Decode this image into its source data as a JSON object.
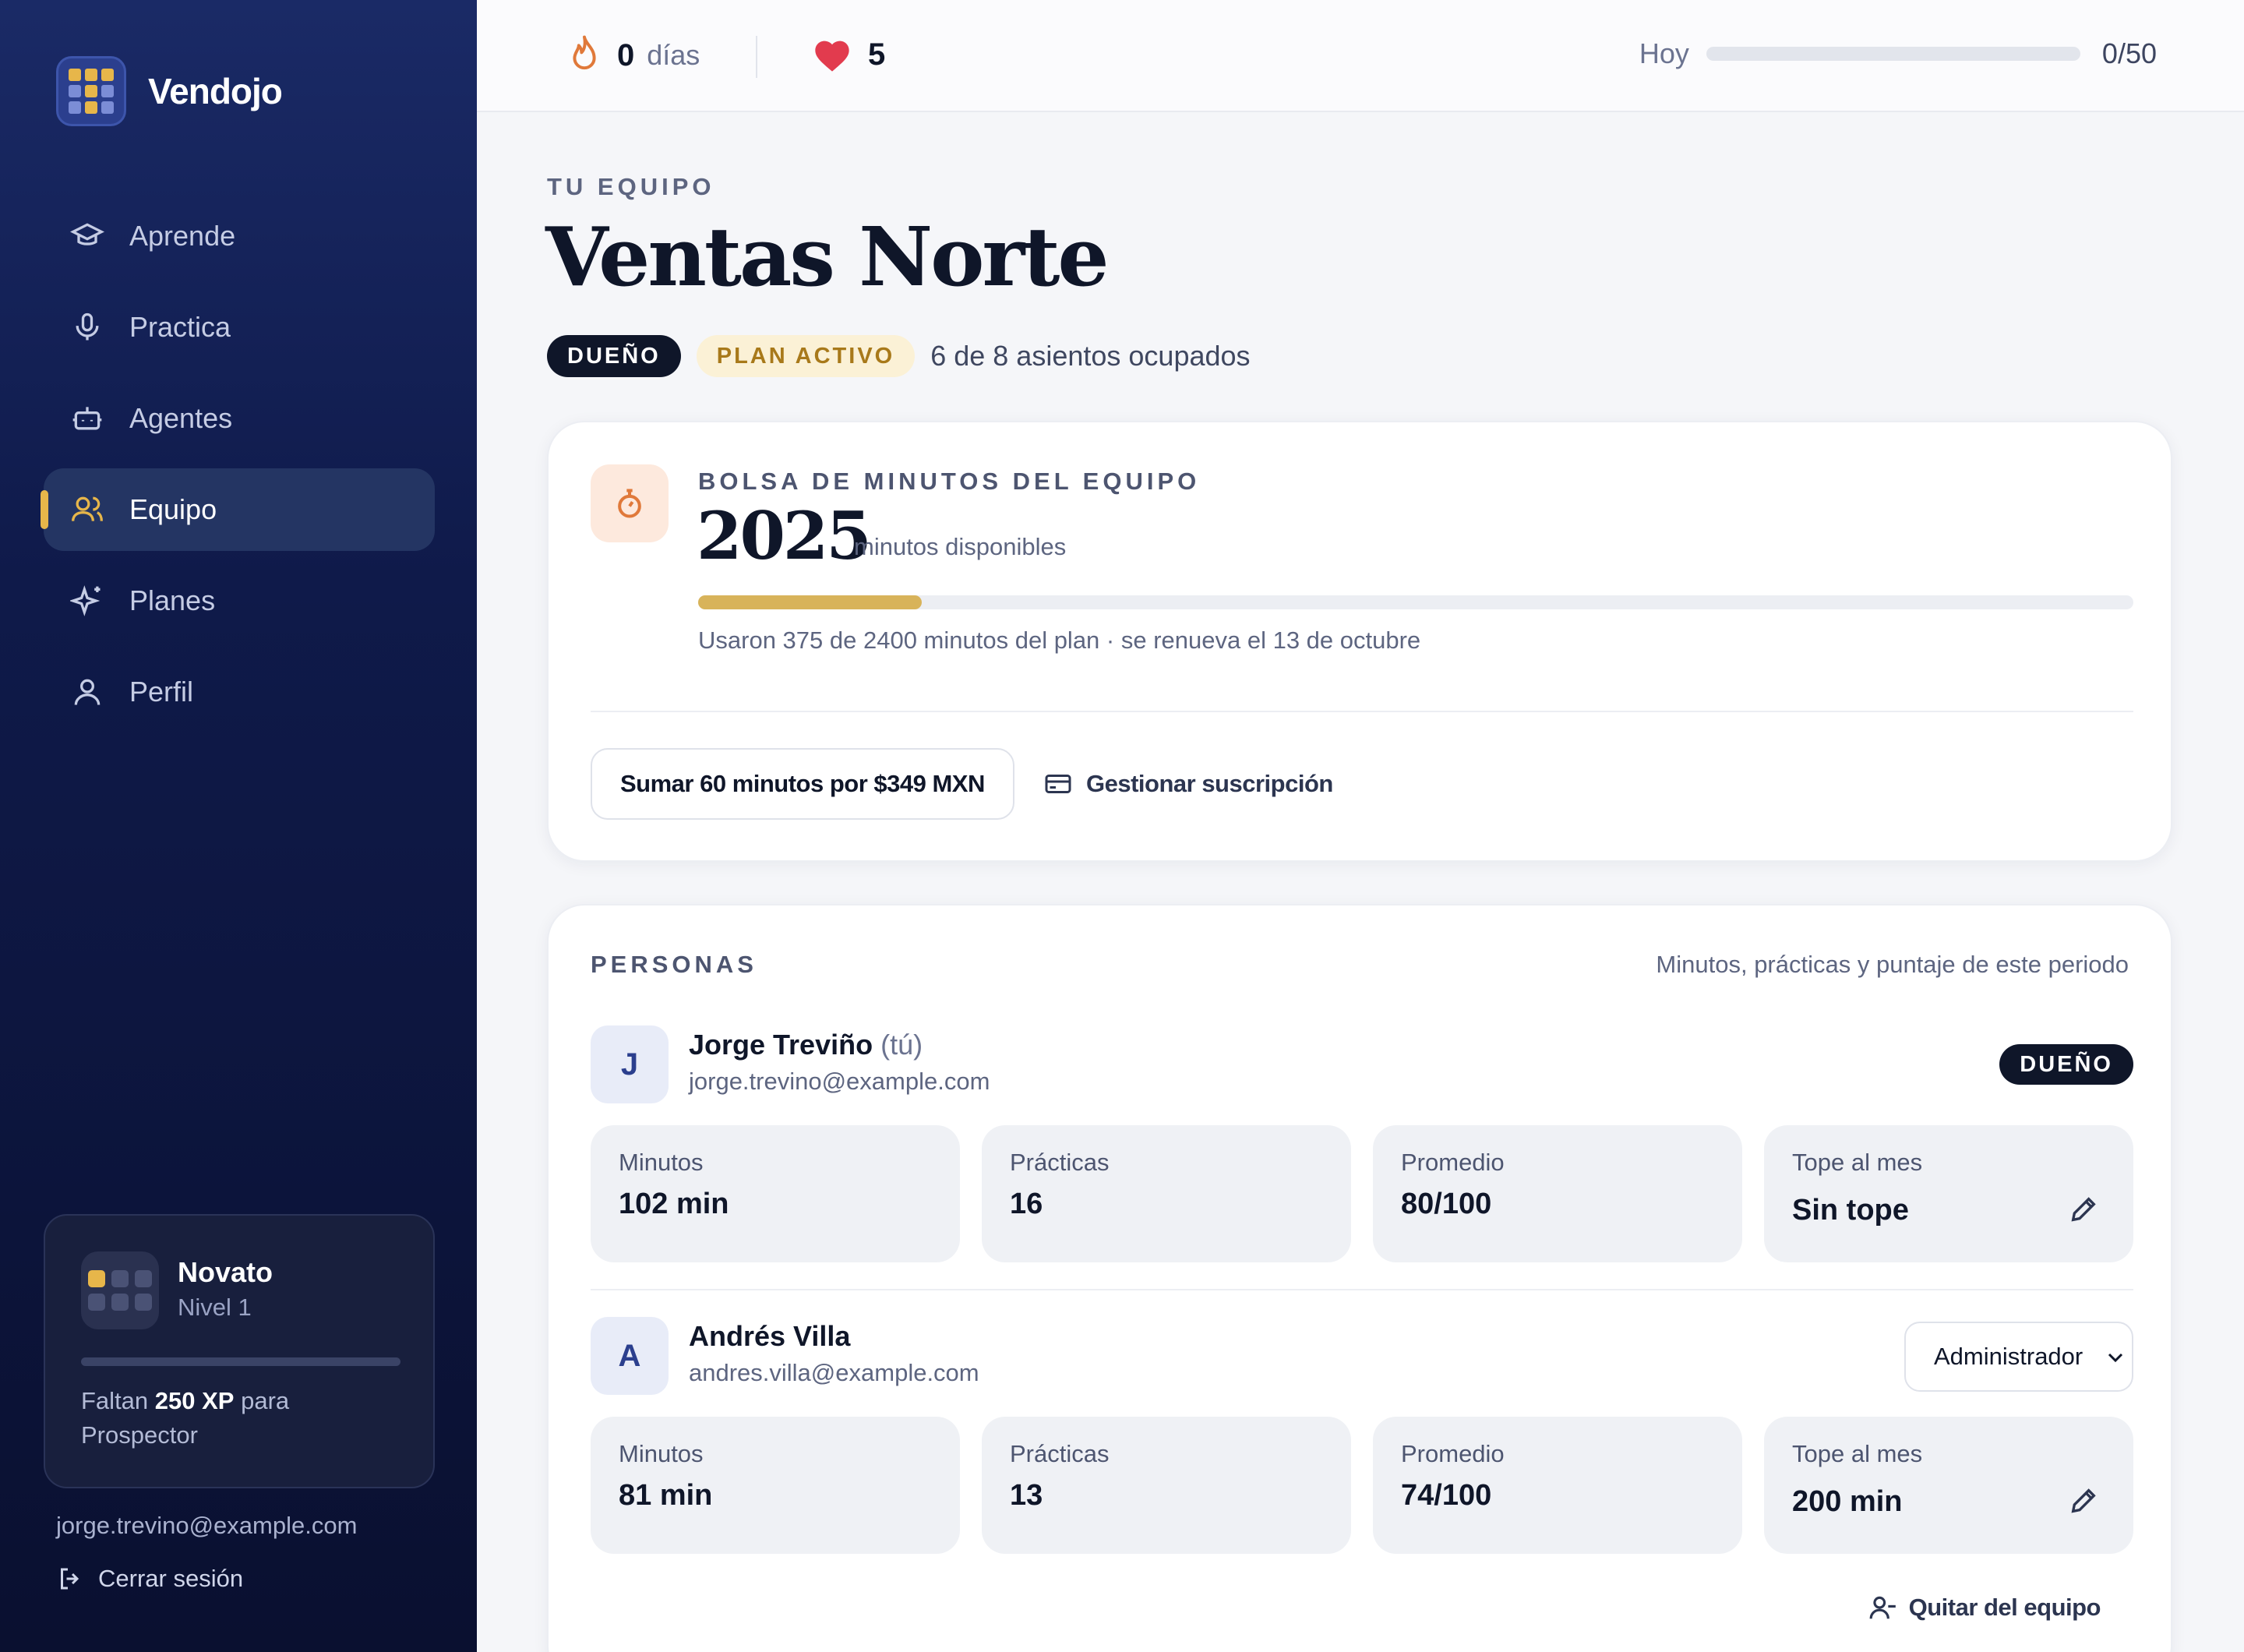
{
  "app": {
    "name": "Vendojo"
  },
  "sidebar": {
    "items": [
      {
        "label": "Aprende",
        "icon": "graduation-cap-icon",
        "active": false
      },
      {
        "label": "Practica",
        "icon": "microphone-icon",
        "active": false
      },
      {
        "label": "Agentes",
        "icon": "robot-icon",
        "active": false
      },
      {
        "label": "Equipo",
        "icon": "users-icon",
        "active": true
      },
      {
        "label": "Planes",
        "icon": "sparkles-icon",
        "active": false
      },
      {
        "label": "Perfil",
        "icon": "user-icon",
        "active": false
      }
    ],
    "level": {
      "title": "Novato",
      "subtitle": "Nivel 1",
      "progress": 0,
      "note_prefix": "Faltan",
      "note_xp": "250 XP",
      "note_suffix": "para Prospector"
    },
    "email": "jorge.trevino@example.com",
    "logout_label": "Cerrar sesión"
  },
  "topbar": {
    "streak_count": "0",
    "streak_label": "días",
    "hearts_count": "5",
    "today_label": "Hoy",
    "today_progress": 0,
    "today_count": "0/50"
  },
  "team": {
    "eyebrow": "TU EQUIPO",
    "name": "Ventas Norte",
    "role_badge": "DUEÑO",
    "plan_badge": "PLAN ACTIVO",
    "seats": "6 de 8 asientos ocupados"
  },
  "pool": {
    "label": "BOLSA DE MINUTOS DEL EQUIPO",
    "value": "2025",
    "unit": "minutos disponibles",
    "used_fraction": 0.156,
    "note": "Usaron 375 de 2400 minutos del plan · se renueva el 13 de octubre",
    "add_button": "Sumar 60 minutos por $349 MXN",
    "manage_button": "Gestionar suscripción"
  },
  "people": {
    "title": "PERSONAS",
    "subtitle": "Minutos, prácticas y puntaje de este periodo",
    "stat_labels": {
      "minutes": "Minutos",
      "practices": "Prácticas",
      "average": "Promedio",
      "cap": "Tope al mes"
    },
    "members": [
      {
        "initial": "J",
        "name": "Jorge Treviño",
        "you": "(tú)",
        "email": "jorge.trevino@example.com",
        "role": "DUEÑO",
        "minutes": "102 min",
        "practices": "16",
        "average": "80/100",
        "cap": "Sin tope"
      },
      {
        "initial": "A",
        "name": "Andrés Villa",
        "email": "andres.villa@example.com",
        "role": "Administrador",
        "minutes": "81 min",
        "practices": "13",
        "average": "74/100",
        "cap": "200 min"
      }
    ],
    "remove_label": "Quitar del equipo"
  }
}
